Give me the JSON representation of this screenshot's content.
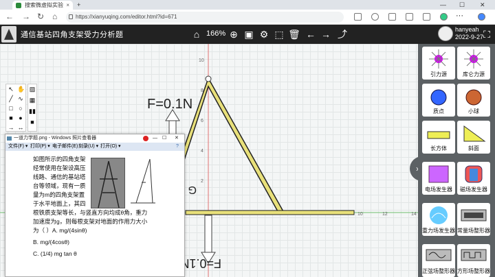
{
  "browser": {
    "tab_title": "搜索微虚拟实验",
    "url": "https://xianyuqing.com/editor.html?id=671",
    "controls": {
      "minimize": "—",
      "maximize": "☐",
      "close": "✕"
    }
  },
  "app": {
    "title": "通信基站四角支架受力分析题",
    "zoom": "166%",
    "user_name": "hanyeah",
    "user_date": "2022-9-27"
  },
  "canvas": {
    "force_top": "F=0.1N",
    "force_bottom": "F=0.1N",
    "g_label": "G",
    "axis_y_ticks": [
      "10",
      "8",
      "6",
      "4",
      "2"
    ],
    "axis_x_ticks": [
      "10",
      "12",
      "14"
    ]
  },
  "palette": {
    "items": [
      {
        "label": "引力源"
      },
      {
        "label": "库仑力源"
      },
      {
        "label": "质点"
      },
      {
        "label": "小球"
      },
      {
        "label": "长方体"
      },
      {
        "label": "斜面"
      },
      {
        "label": "电场发生器"
      },
      {
        "label": "磁场发生器"
      },
      {
        "label": "重力场发生器"
      },
      {
        "label": "常量场整形器"
      },
      {
        "label": "正弦场整形器"
      },
      {
        "label": "方形场整形器"
      }
    ]
  },
  "viewer": {
    "title": "一道力学题.png - Windows 照片查看器",
    "menu": [
      "文件(F) ▾",
      "打印(P) ▾",
      "电子邮件(E)",
      "刻录(U) ▾",
      "打开(O) ▾"
    ],
    "problem_lines": [
      "如图所示的四角支架",
      "经常使用在架设高压",
      "线路、通信的基站塔",
      "台等领域，现有一质",
      "量为m的四角支架置",
      "于水平地面上，其四",
      "根铁质支架等长，与竖直方向均成θ角，重力",
      "加速度为g，则每根支架对地面的作用力大小",
      "为（ ）A. mg/(4sinθ)"
    ],
    "option_b": "B. mg/(4cosθ)",
    "option_c": "C. (1/4) mg tan θ"
  }
}
